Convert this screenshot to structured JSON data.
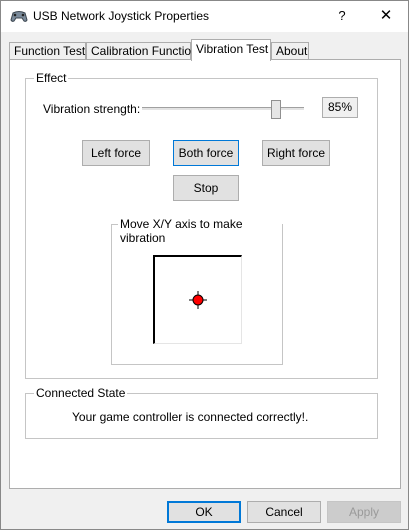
{
  "window": {
    "title": "USB Network Joystick Properties",
    "help_label": "?",
    "close_label": "✕"
  },
  "tabs": [
    {
      "label": "Function Test"
    },
    {
      "label": "Calibration Function"
    },
    {
      "label": "Vibration Test"
    },
    {
      "label": "About"
    }
  ],
  "effect": {
    "group_label": "Effect",
    "strength_label": "Vibration strength:",
    "strength_value": "85%",
    "strength_fraction": 0.85,
    "buttons": {
      "left": "Left force",
      "both": "Both force",
      "right": "Right force",
      "stop": "Stop"
    },
    "axis_group_label": "Move X/Y axis to make vibration"
  },
  "connected": {
    "group_label": "Connected State",
    "status_text": "Your game controller is connected correctly!."
  },
  "footer": {
    "ok": "OK",
    "cancel": "Cancel",
    "apply": "Apply"
  },
  "colors": {
    "accent": "#0078d7",
    "crosshair": "#ff0000"
  }
}
